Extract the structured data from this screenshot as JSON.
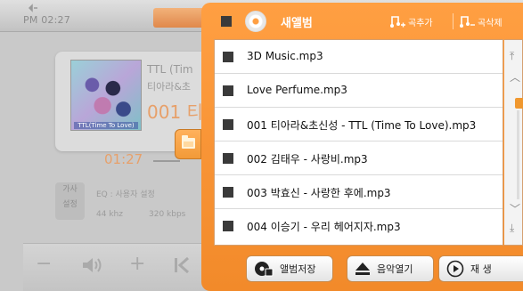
{
  "status": {
    "time": "PM 02:27"
  },
  "player": {
    "album_caption": "TTL(Time To Love)",
    "title": "TTL (Tim",
    "artist": "티아라&초",
    "track_number": "001 티",
    "elapsed": "01:27",
    "info_box": [
      "가사",
      "설정"
    ],
    "eq": "EQ : 사용자 설정",
    "sample_rate": "44 khz",
    "bitrate": "320 kbps"
  },
  "playlist": {
    "title": "새앨범",
    "add_song_label": "곡추가",
    "delete_song_label": "곡삭제",
    "items": [
      {
        "name": "3D Music.mp3"
      },
      {
        "name": "Love Perfume.mp3"
      },
      {
        "name": "001 티아라&초신성 - TTL (Time To Love).mp3"
      },
      {
        "name": "002 김태우 - 사랑비.mp3"
      },
      {
        "name": "003 박효신 - 사랑한 후에.mp3"
      },
      {
        "name": "004 이승기 - 우리 헤어지자.mp3"
      }
    ],
    "buttons": {
      "save_album": "앨범저장",
      "open_music": "음악열기",
      "play": "재 생"
    }
  },
  "colors": {
    "accent": "#f28a2a",
    "accent_light": "#ff9f42",
    "dim_text": "#9a9a9a",
    "orange_text": "#e7a06a"
  }
}
